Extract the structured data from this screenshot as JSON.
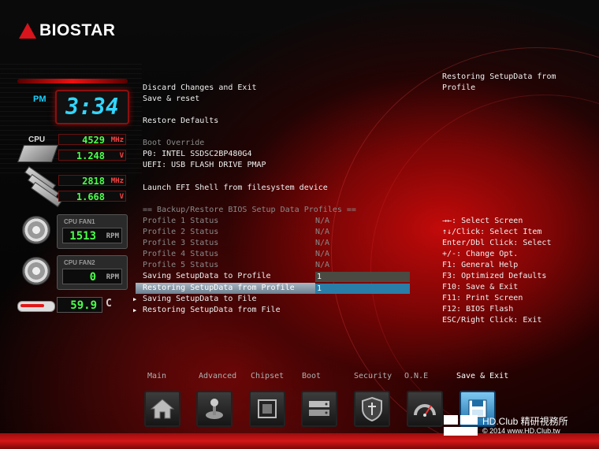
{
  "brand": {
    "name": "BIOSTAR",
    "color": "#d8141c"
  },
  "hardware": {
    "clock": {
      "ampm": "PM",
      "time": "3:34"
    },
    "cpu": {
      "label": "CPU",
      "freq": "4529",
      "freq_unit": "MHz",
      "volt": "1.248",
      "volt_unit": "V"
    },
    "memory": {
      "freq": "2818",
      "freq_unit": "MHz",
      "volt": "1.668",
      "volt_unit": "V"
    },
    "cpu_fan1": {
      "label": "CPU FAN1",
      "rpm": "1513",
      "unit": "RPM"
    },
    "cpu_fan2": {
      "label": "CPU FAN2",
      "rpm": "0",
      "unit": "RPM"
    },
    "temperature": {
      "value": "59.9",
      "unit": "C"
    }
  },
  "menu": {
    "items": [
      {
        "label": "Discard Changes and Exit"
      },
      {
        "label": "Save & reset"
      },
      {
        "label": "Restore Defaults"
      },
      {
        "label": "Boot Override"
      },
      {
        "label": "P0: INTEL SSDSC2BP480G4"
      },
      {
        "label": "UEFI:  USB FLASH DRIVE PMAP"
      },
      {
        "label": "Launch EFI Shell from filesystem device"
      },
      {
        "label": "== Backup/Restore BIOS Setup Data Profiles =="
      }
    ],
    "profiles": [
      {
        "label": "Profile 1 Status",
        "value": "N/A"
      },
      {
        "label": "Profile 2 Status",
        "value": "N/A"
      },
      {
        "label": "Profile 3 Status",
        "value": "N/A"
      },
      {
        "label": "Profile 4 Status",
        "value": "N/A"
      },
      {
        "label": "Profile 5 Status",
        "value": "N/A"
      }
    ],
    "saving": {
      "label": "Saving SetupData to Profile",
      "value": "1"
    },
    "restoring": {
      "label": "Restoring SetupData from Profile",
      "value": "1"
    },
    "save_file": {
      "label": "Saving SetupData to File"
    },
    "restore_file": {
      "label": "Restoring SetupData from File"
    }
  },
  "help": {
    "description": [
      "Restoring SetupData from",
      "Profile"
    ],
    "keys": [
      "→←: Select Screen",
      "↑↓/Click: Select Item",
      "Enter/Dbl Click: Select",
      "+/-: Change Opt.",
      "F1: General Help",
      "F3: Optimized Defaults",
      "F10: Save & Exit",
      "F11: Print Screen",
      "F12: BIOS Flash",
      "ESC/Right Click: Exit"
    ]
  },
  "tabs": [
    {
      "label": "Main",
      "icon": "home-icon"
    },
    {
      "label": "Advanced",
      "icon": "joystick-icon"
    },
    {
      "label": "Chipset",
      "icon": "chip-icon"
    },
    {
      "label": "Boot",
      "icon": "drive-icon"
    },
    {
      "label": "Security",
      "icon": "shield-icon"
    },
    {
      "label": "O.N.E",
      "icon": "gauge-icon"
    },
    {
      "label": "Save & Exit",
      "icon": "save-exit-icon",
      "active": true
    }
  ],
  "watermark": {
    "name": "HD.Club 精研視務所",
    "copyright": "© 2014  www.HD.Club.tw"
  }
}
